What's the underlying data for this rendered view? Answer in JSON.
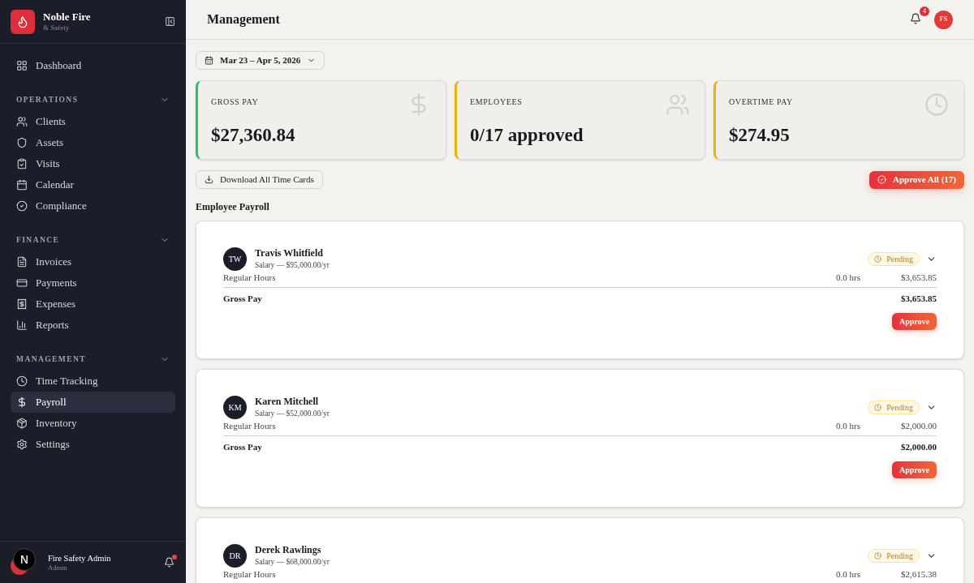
{
  "brand": {
    "name": "Noble Fire",
    "tagline": "& Safety"
  },
  "sidebar": {
    "top_items": [
      {
        "label": "Dashboard",
        "selected": false
      }
    ],
    "sections": [
      {
        "title": "OPERATIONS",
        "expanded": true,
        "items": [
          {
            "label": "Clients",
            "selected": false
          },
          {
            "label": "Assets",
            "selected": false
          },
          {
            "label": "Visits",
            "selected": false
          },
          {
            "label": "Calendar",
            "selected": false
          },
          {
            "label": "Compliance",
            "selected": false
          }
        ]
      },
      {
        "title": "FINANCE",
        "expanded": true,
        "items": [
          {
            "label": "Invoices",
            "selected": false
          },
          {
            "label": "Payments",
            "selected": false
          },
          {
            "label": "Expenses",
            "selected": false
          },
          {
            "label": "Reports",
            "selected": false
          }
        ]
      },
      {
        "title": "MANAGEMENT",
        "expanded": true,
        "items": [
          {
            "label": "Time Tracking",
            "selected": false
          },
          {
            "label": "Payroll",
            "selected": true
          },
          {
            "label": "Inventory",
            "selected": false
          },
          {
            "label": "Settings",
            "selected": false
          }
        ]
      }
    ],
    "user": {
      "name": "Fire Safety Admin",
      "role": "Admin",
      "indicator": "N",
      "has_notifications": true
    }
  },
  "header": {
    "title": "Management",
    "notification_count": "4",
    "avatar": "FS"
  },
  "date_range": "Mar 23 – Apr 5, 2026",
  "stats": [
    {
      "label": "GROSS PAY",
      "value": "$27,360.84",
      "color": "#22c55e"
    },
    {
      "label": "EMPLOYEES",
      "value": "0/17 approved",
      "color": "#eab308"
    },
    {
      "label": "OVERTIME PAY",
      "value": "$274.95",
      "color": "#eab308"
    }
  ],
  "download_button": "Download All Time Cards",
  "approve_all_button": "Approve All (17)",
  "section_title": "Employee Payroll",
  "employees": [
    {
      "initials": "TW",
      "name": "Travis Whitfield",
      "salary": "Salary — $95,000.00/yr",
      "status": "Pending",
      "rows": [
        {
          "kind": "line",
          "label": "Regular Hours",
          "hours": "0.0 hrs",
          "amount": "$3,653.85"
        },
        {
          "kind": "total",
          "label": "Gross Pay",
          "amount": "$3,653.85"
        }
      ],
      "approve": "Approve"
    },
    {
      "initials": "KM",
      "name": "Karen Mitchell",
      "salary": "Salary — $52,000.00/yr",
      "status": "Pending",
      "rows": [
        {
          "kind": "line",
          "label": "Regular Hours",
          "hours": "0.0 hrs",
          "amount": "$2,000.00"
        },
        {
          "kind": "total",
          "label": "Gross Pay",
          "amount": "$2,000.00"
        }
      ],
      "approve": "Approve"
    },
    {
      "initials": "DR",
      "name": "Derek Rawlings",
      "salary": "Salary — $68,000.00/yr",
      "status": "Pending",
      "rows": [
        {
          "kind": "line",
          "label": "Regular Hours",
          "hours": "0.0 hrs",
          "amount": "$2,615.38"
        }
      ]
    }
  ]
}
